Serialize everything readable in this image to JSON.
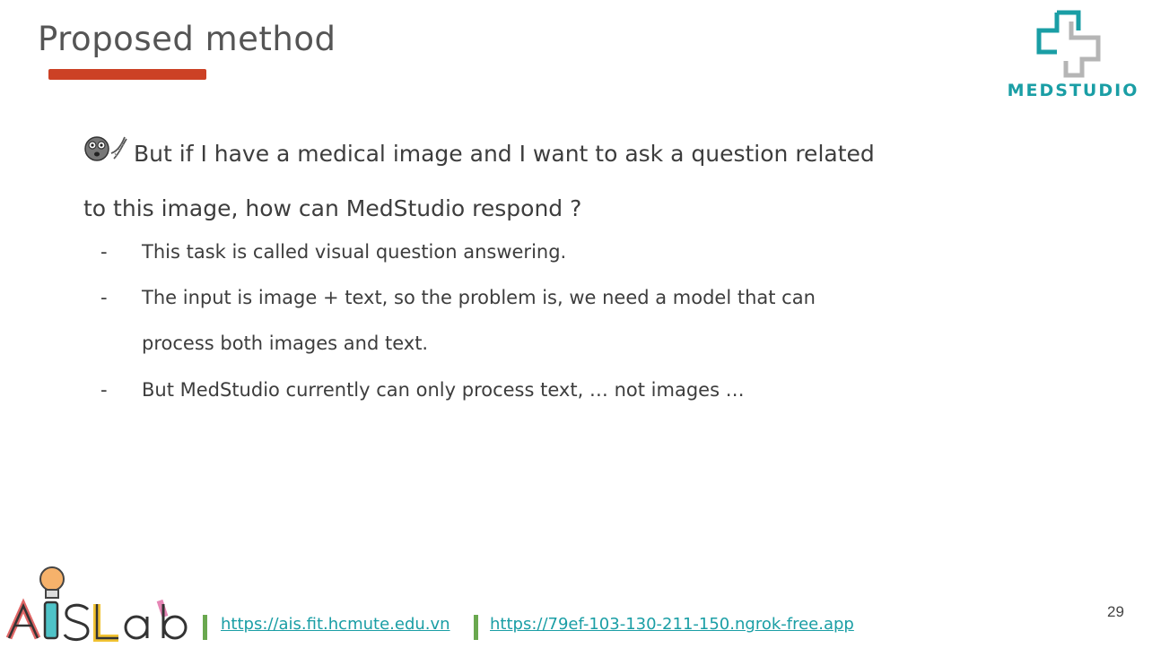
{
  "slide": {
    "title": "Proposed method",
    "logo_text": "MEDSTUDIO",
    "question": {
      "line1": "But if I have a medical image and I want to ask a question related",
      "line2": "to this image, how can MedStudio respond ?"
    },
    "bullets": [
      {
        "dash": "-",
        "text": "This task is called visual question answering."
      },
      {
        "dash": "-",
        "text": "The input is image + text, so the problem is, we need a model that can"
      },
      {
        "dash": "",
        "text": "process both images and text."
      },
      {
        "dash": "-",
        "text": "But MedStudio currently can only process text, … not images …"
      }
    ],
    "footer": {
      "lab_logo_text": "AISLab",
      "link1": "https://ais.fit.hcmute.edu.vn",
      "link2": "https://79ef-103-130-211-150.ngrok-free.app"
    },
    "page_number": "29"
  },
  "colors": {
    "accent_red": "#cc4125",
    "teal": "#1a9ea5",
    "green": "#6aa84f",
    "text": "#3d3d3d"
  },
  "icons": [
    "thinking-face-icon",
    "dna-icon",
    "medstudio-cross-logo",
    "lightbulb-icon"
  ]
}
